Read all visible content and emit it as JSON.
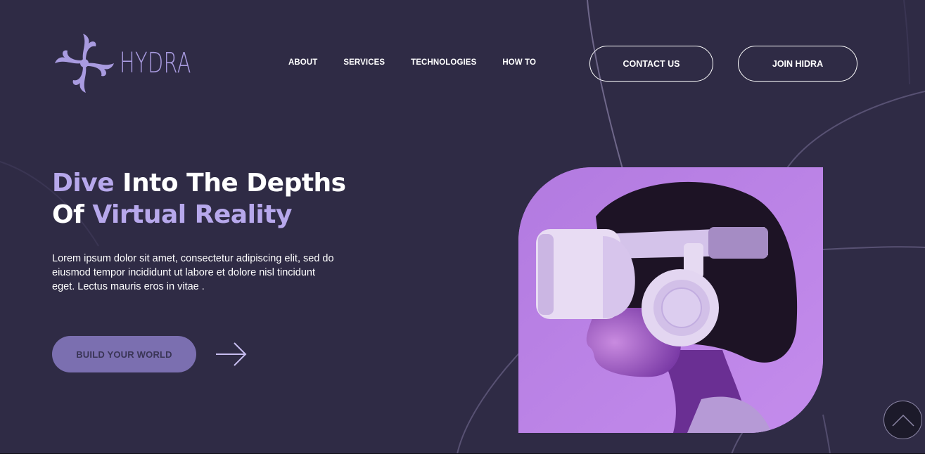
{
  "brand": {
    "name": "HYDRA",
    "logo_icon": "hydra-swirl-icon",
    "accent_color": "#b7a8ec"
  },
  "nav": {
    "items": [
      {
        "label": "ABOUT"
      },
      {
        "label": "SERVICES"
      },
      {
        "label": "TECHNOLOGIES"
      },
      {
        "label": "HOW TO"
      }
    ]
  },
  "header_buttons": {
    "contact": "CONTACT US",
    "join": "JOIN HIDRA"
  },
  "hero": {
    "title_word1": "Dive",
    "title_part2": " Into The Depths",
    "title_word3": "Of ",
    "title_part4": "Virtual Reality",
    "description": "Lorem ipsum dolor sit amet, consectetur adipiscing elit, sed do eiusmod tempor incididunt ut labore et dolore nisl tincidunt eget. Lectus mauris eros in vitae .",
    "cta_label": "BUILD YOUR WORLD",
    "cta_icon": "arrow-right-icon",
    "image_subject": "vr-headset-person-image"
  },
  "scroll_top": {
    "icon": "chevron-up-icon"
  },
  "colors": {
    "background": "#2f2b45",
    "cta_background": "#7b6fb0",
    "image_background": "#b47be2"
  }
}
